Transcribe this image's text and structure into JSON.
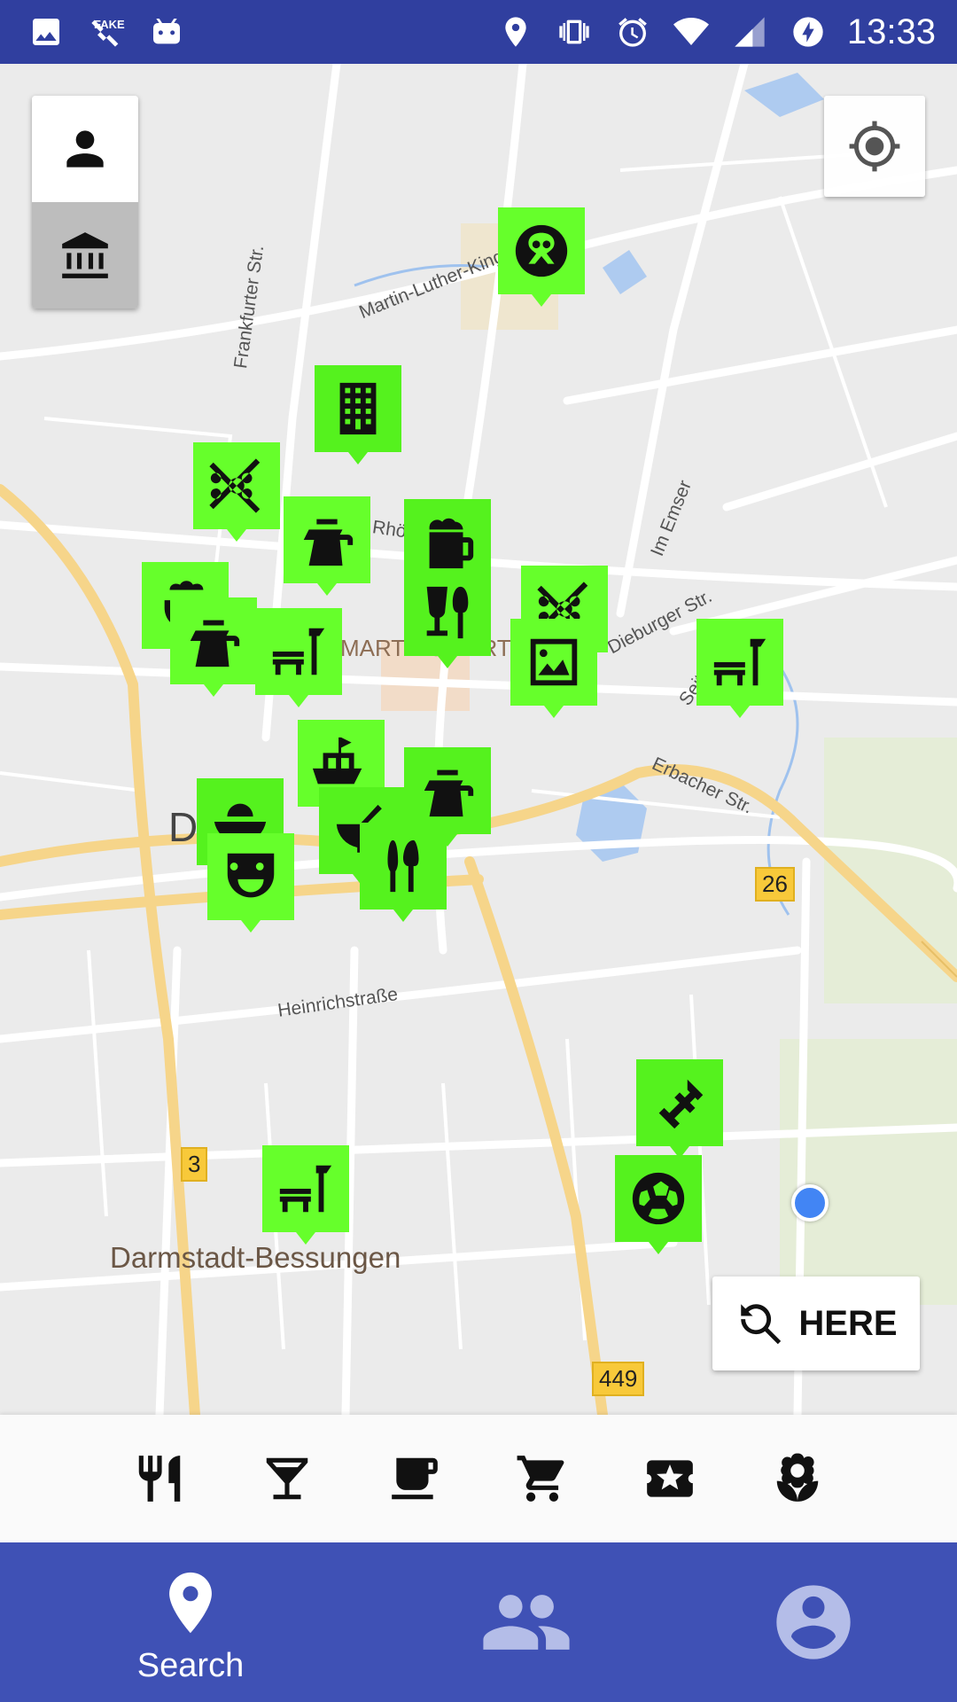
{
  "status_bar": {
    "time": "13:33",
    "left_icons": [
      "image-icon",
      "fake-gps-icon",
      "robot-icon"
    ],
    "fake_gps_text": "FAKE",
    "right_icons": [
      "location-icon",
      "vibrate-icon",
      "alarm-icon",
      "wifi-icon",
      "signal-icon",
      "battery-charging-icon"
    ]
  },
  "map": {
    "street_labels": [
      "Martin-Luther-King-",
      "Frankfurter Str.",
      "Rhönr",
      "Im Emser",
      "Dieburger Str.",
      "Seit",
      "Erbacher Str.",
      "Heinrichstraße"
    ],
    "area_labels": [
      "MARTINSVIERTE",
      "Da",
      "Darmstadt-Bessungen"
    ],
    "road_shields": [
      "26",
      "3",
      "449"
    ],
    "markers": [
      "pretzel-icon",
      "building-icon",
      "skewer-icon",
      "kettle-icon",
      "beer-icon",
      "bbq-icon",
      "kettle-icon",
      "bench-icon",
      "skewer-icon",
      "glass-cutlery-icon",
      "picture-icon",
      "bench-icon",
      "ship-icon",
      "kettle-icon",
      "rice-bowl-icon",
      "soup-bowl-icon",
      "theater-icon",
      "cutlery-icon",
      "dumbbell-icon",
      "soccer-icon",
      "bench-icon"
    ],
    "marker_color": "#66ff2b",
    "user_location_color": "#4285f4"
  },
  "layer_buttons": [
    "person-icon",
    "museum-icon"
  ],
  "locate_button": "my-location-icon",
  "here_button": {
    "label": "HERE",
    "icon": "search-refresh-icon"
  },
  "categories": [
    "restaurant-icon",
    "bar-icon",
    "cafe-icon",
    "shopping-cart-icon",
    "ticket-icon",
    "flower-icon"
  ],
  "bottom_nav": {
    "items": [
      {
        "label": "Search",
        "icon": "location-pin-icon",
        "active": true
      },
      {
        "label": "",
        "icon": "people-icon",
        "active": false
      },
      {
        "label": "",
        "icon": "account-icon",
        "active": false
      }
    ],
    "background": "#3f51b5"
  },
  "colors": {
    "status_bar": "#303f9f",
    "accent_marker": "#66ff2b"
  }
}
